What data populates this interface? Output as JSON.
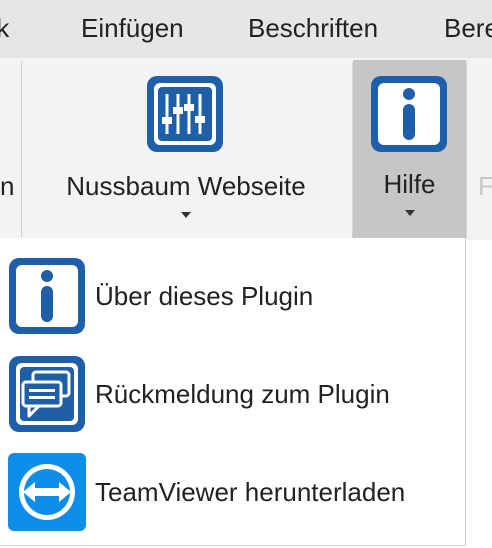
{
  "tabs": [
    {
      "label": "nik"
    },
    {
      "label": "Einfügen"
    },
    {
      "label": "Beschriften"
    },
    {
      "label": "Bere"
    }
  ],
  "ribbon": {
    "partial_left_label": "n",
    "partial_right_label": "F",
    "buttons": [
      {
        "label": "Nussbaum Webseite",
        "icon": "sliders-icon"
      },
      {
        "label": "Hilfe",
        "icon": "info-icon",
        "state": "pressed"
      }
    ]
  },
  "dropdown": {
    "items": [
      {
        "label": "Über dieses Plugin",
        "icon": "info-icon"
      },
      {
        "label": "Rückmeldung zum Plugin",
        "icon": "chat-bubbles-icon"
      },
      {
        "label": "TeamViewer herunterladen",
        "icon": "teamviewer-icon"
      }
    ]
  },
  "colors": {
    "brand_blue": "#1f5ea8",
    "teamviewer_blue": "#0e8ee9",
    "tabbar_bg": "#e6e6e6",
    "ribbon_bg": "#f3f3f3",
    "pressed_bg": "#c6c6c6"
  }
}
